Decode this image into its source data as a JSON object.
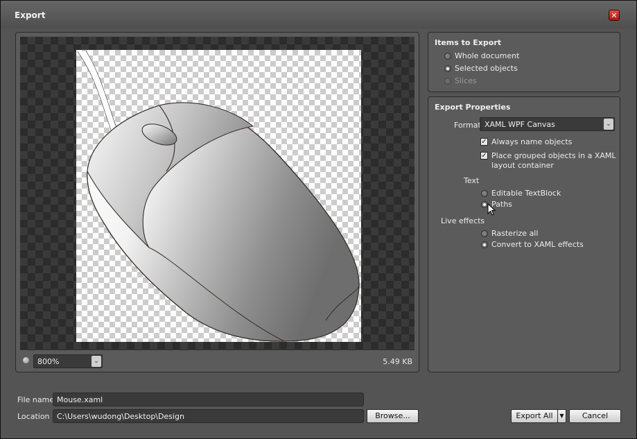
{
  "window": {
    "title": "Export",
    "close_glyph": "✕"
  },
  "preview": {
    "zoom_value": "800%",
    "file_size": "5.49 KB",
    "zoom_dropdown_glyph": "⌄"
  },
  "items_to_export": {
    "title": "Items to Export",
    "options": [
      {
        "label": "Whole document",
        "checked": false,
        "disabled": false
      },
      {
        "label": "Selected objects",
        "checked": true,
        "disabled": false
      },
      {
        "label": "Slices",
        "checked": false,
        "disabled": true
      }
    ]
  },
  "export_properties": {
    "title": "Export Properties",
    "format_label": "Format",
    "format_value": "XAML WPF Canvas",
    "checkboxes": [
      {
        "label": "Always name objects",
        "checked": true
      },
      {
        "label": "Place grouped objects in a XAML",
        "label2": "layout container",
        "checked": true
      }
    ],
    "text_group_label": "Text",
    "text_options": [
      {
        "label": "Editable TextBlock",
        "checked": false
      },
      {
        "label": "Paths",
        "checked": true
      }
    ],
    "live_effects_label": "Live effects",
    "live_effects_options": [
      {
        "label": "Rasterize all",
        "checked": false
      },
      {
        "label": "Convert to XAML effects",
        "checked": true
      }
    ]
  },
  "file": {
    "file_name_label": "File name",
    "file_name_value": "Mouse.xaml",
    "location_label": "Location",
    "location_value": "C:\\Users\\wudong\\Desktop\\Design"
  },
  "buttons": {
    "browse": "Browse...",
    "export_all": "Export All",
    "cancel": "Cancel"
  }
}
